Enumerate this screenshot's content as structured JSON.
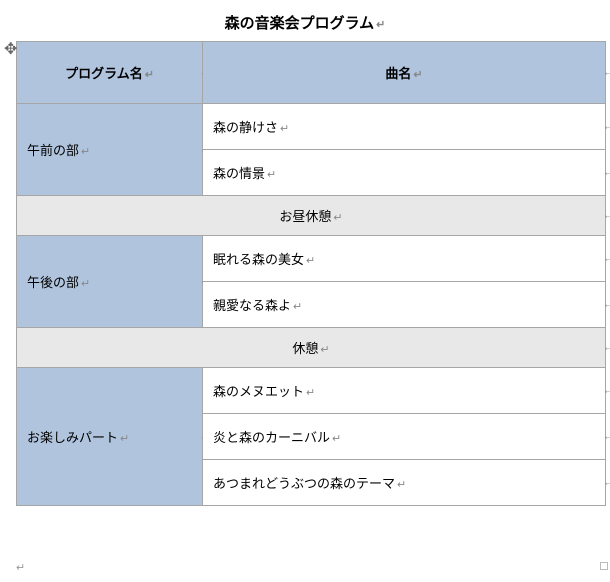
{
  "title": "森の音楽会プログラム",
  "headers": {
    "program": "プログラム名",
    "song": "曲名"
  },
  "sections": [
    {
      "program": "午前の部",
      "songs": [
        "森の静けさ",
        "森の情景"
      ]
    },
    {
      "break": "お昼休憩"
    },
    {
      "program": "午後の部",
      "songs": [
        "眠れる森の美女",
        "親愛なる森よ"
      ]
    },
    {
      "break": "休憩"
    },
    {
      "program": "お楽しみパート",
      "songs": [
        "森のメヌエット",
        "炎と森のカーニバル",
        "あつまれどうぶつの森のテーマ"
      ]
    }
  ],
  "marks": {
    "return": "↵",
    "cellend": "←",
    "anchor": "✥"
  }
}
